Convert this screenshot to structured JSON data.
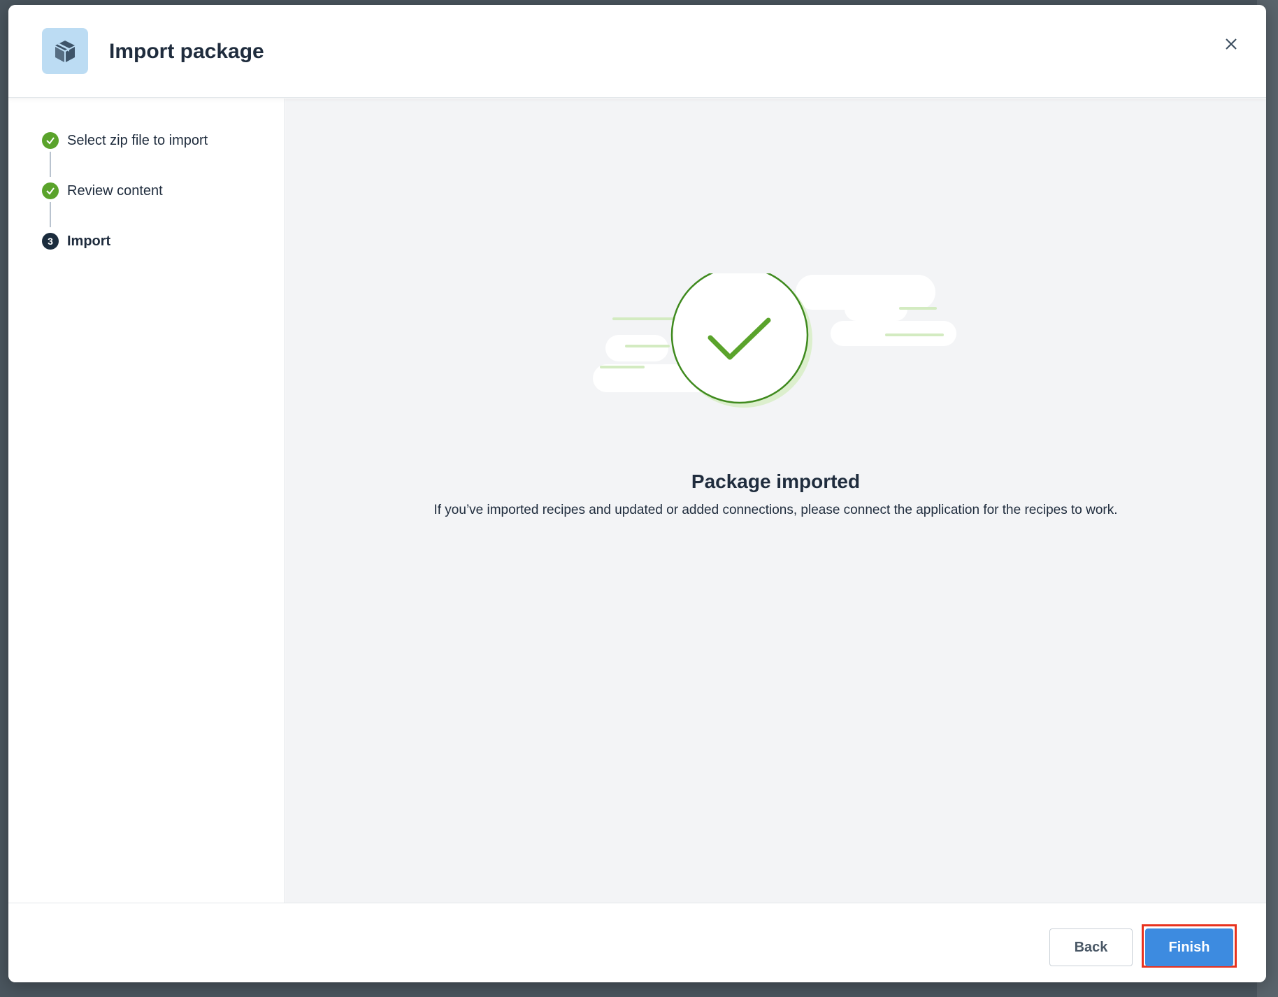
{
  "dialog": {
    "title": "Import package",
    "icon": "package-icon",
    "close_icon": "close-icon"
  },
  "steps": [
    {
      "label": "Select zip file to import",
      "status": "done"
    },
    {
      "label": "Review content",
      "status": "done"
    },
    {
      "number": "3",
      "label": "Import",
      "status": "current"
    }
  ],
  "result": {
    "title": "Package imported",
    "description": "If you’ve imported recipes and updated or added connections, please connect the application for the recipes to work.",
    "icon": "success-check-icon"
  },
  "footer": {
    "back_label": "Back",
    "finish_label": "Finish"
  },
  "colors": {
    "accent": "#3d8be0",
    "success": "#5aa32b",
    "highlight_outline": "#e8321e"
  }
}
